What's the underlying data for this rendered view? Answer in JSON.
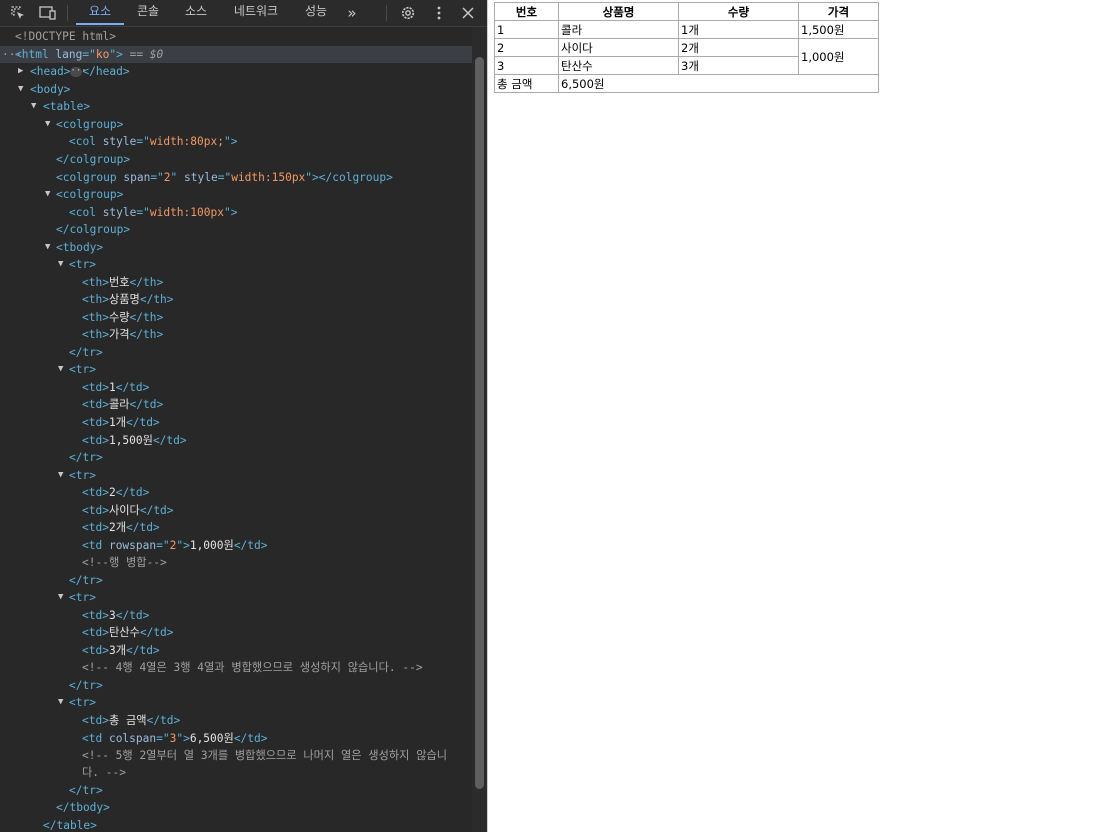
{
  "toolbar": {
    "tabs": [
      "요소",
      "콘솔",
      "소스",
      "네트워크",
      "성능"
    ],
    "more_tabs_icon": "double-chevron-right-icon",
    "icons": [
      "inspect-element-icon",
      "device-toolbar-icon",
      "settings-gear-icon",
      "kebab-menu-icon",
      "close-icon"
    ]
  },
  "dom": {
    "doctype": "<!DOCTYPE html>",
    "html_lang": "ko",
    "selected_suffix": "== $0",
    "col1_style": "width:80px;",
    "colgroup_span": "2",
    "colgroup_style": "width:150px",
    "col4_style": "width:100px",
    "rowspan": "2",
    "colspan": "3",
    "comment_rowspan": "<!--행 병합-->",
    "comment_row4": "<!-- 4행 4열은 3행 4열과 병합했으므로 생성하지 않습니다. -->",
    "comment_row5_a": "<!-- 5행 2열부터 열 3개를 병합했으므로 나머지 열은 생성하지 않습니",
    "comment_row5_b": "다. -->"
  },
  "table": {
    "headers": [
      "번호",
      "상품명",
      "수량",
      "가격"
    ],
    "rows": [
      [
        "1",
        "콜라",
        "1개",
        "1,500원"
      ],
      [
        "2",
        "사이다",
        "2개",
        "1,000원"
      ],
      [
        "3",
        "탄산수",
        "3개"
      ]
    ],
    "total_label": "총 금액",
    "total_value": "6,500원"
  }
}
